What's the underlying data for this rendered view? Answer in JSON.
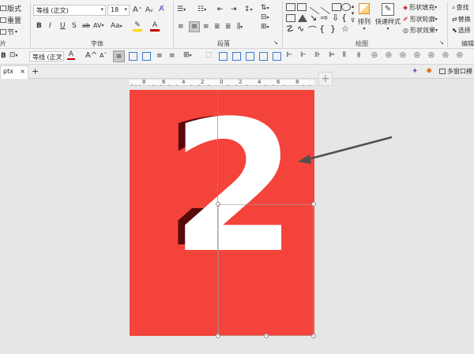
{
  "ribbon": {
    "clipboard": {
      "layout_label": "版式",
      "reset_label": "重置",
      "section_label": "节",
      "group_label": "片"
    },
    "font": {
      "font_name": "等线 (正文)",
      "font_size": "18",
      "grow_label": "A",
      "shrink_label": "A",
      "bold": "B",
      "italic": "I",
      "underline": "U",
      "strike": "S",
      "spacing_label": "AV",
      "case_label": "Aa",
      "group_label": "字体"
    },
    "paragraph": {
      "group_label": "段落"
    },
    "drawing": {
      "arrange_label": "排列",
      "quick_styles_label": "快速样式",
      "fill_label": "形状填充",
      "outline_label": "形状轮廓",
      "effects_label": "形状效果",
      "group_label": "绘图"
    },
    "editing": {
      "find_label": "查找",
      "replace_label": "替换",
      "select_label": "选择",
      "group_label": "编辑"
    }
  },
  "toolbar2": {
    "font_name": "等线 (正文",
    "bold": "B"
  },
  "tabs": {
    "doc_tab": "ptx",
    "new_tab": "+",
    "multi_window": "多窗口模"
  },
  "ruler": {
    "labels": [
      "8",
      "6",
      "4",
      "2",
      "0",
      "2",
      "4",
      "6",
      "8"
    ]
  },
  "slide": {
    "big_digit": "2",
    "bg_color": "#f4433a",
    "digit_color": "#ffffff",
    "shadow_color": "#5a0a0a"
  },
  "colors": {
    "highlight": "#ffd800",
    "font_color": "#c00000",
    "arrow": "#505050"
  }
}
